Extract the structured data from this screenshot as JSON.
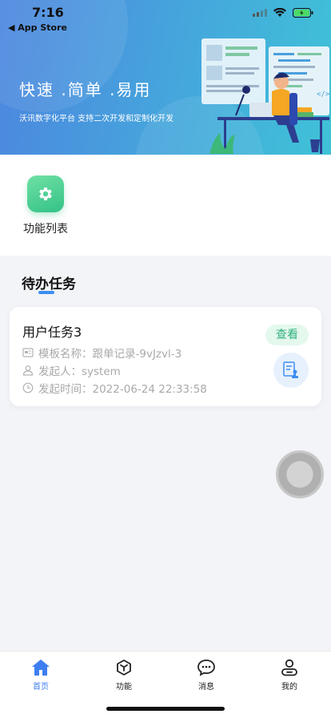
{
  "status_bar": {
    "time": "7:16",
    "back_label": "◀ App Store"
  },
  "hero": {
    "title": "快速 .简单 .易用",
    "subtitle": "沃讯数字化平台 支持二次开发和定制化开发"
  },
  "functions": [
    {
      "label": "功能列表",
      "icon": "gear-icon"
    }
  ],
  "todo": {
    "title": "待办任务",
    "tasks": [
      {
        "name": "用户任务3",
        "template": "模板名称：跟单记录-9vJzvl-3",
        "initiator": "发起人：system",
        "time": "发起时间：2022-06-24 22:33:58",
        "view_label": "查看"
      }
    ]
  },
  "tabbar": {
    "tabs": [
      {
        "label": "首页",
        "icon": "home-icon",
        "active": true
      },
      {
        "label": "功能",
        "icon": "cube-icon",
        "active": false
      },
      {
        "label": "消息",
        "icon": "chat-icon",
        "active": false
      },
      {
        "label": "我的",
        "icon": "user-icon",
        "active": false
      }
    ]
  },
  "colors": {
    "accent": "#3d7ef0",
    "green": "#34c287",
    "hero_start": "#4c86df",
    "hero_end": "#3fc2d7"
  }
}
